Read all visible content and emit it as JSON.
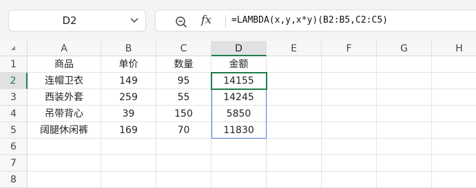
{
  "name_box": {
    "value": "D2"
  },
  "formula_bar": {
    "fx_label": "fx",
    "formula": "=LAMBDA(x,y,x*y)(B2:B5,C2:C5)"
  },
  "columns": [
    "A",
    "B",
    "C",
    "D",
    "E",
    "F",
    "G",
    "H"
  ],
  "selected_column": "D",
  "rows": [
    "1",
    "2",
    "3",
    "4",
    "5",
    "6",
    "7",
    "8"
  ],
  "selected_row": "2",
  "selected_cell": "D2",
  "spill_range": "D2:D5",
  "cells": [
    [
      "商品",
      "单价",
      "数量",
      "金额"
    ],
    [
      "连帽卫衣",
      "149",
      "95",
      "14155"
    ],
    [
      "西装外套",
      "259",
      "55",
      "14245"
    ],
    [
      "吊带背心",
      "39",
      "150",
      "5850"
    ],
    [
      "阔腿休闲裤",
      "169",
      "70",
      "11830"
    ]
  ],
  "colors": {
    "selection": "#1e7a48",
    "spill_border": "#4a76c9"
  }
}
